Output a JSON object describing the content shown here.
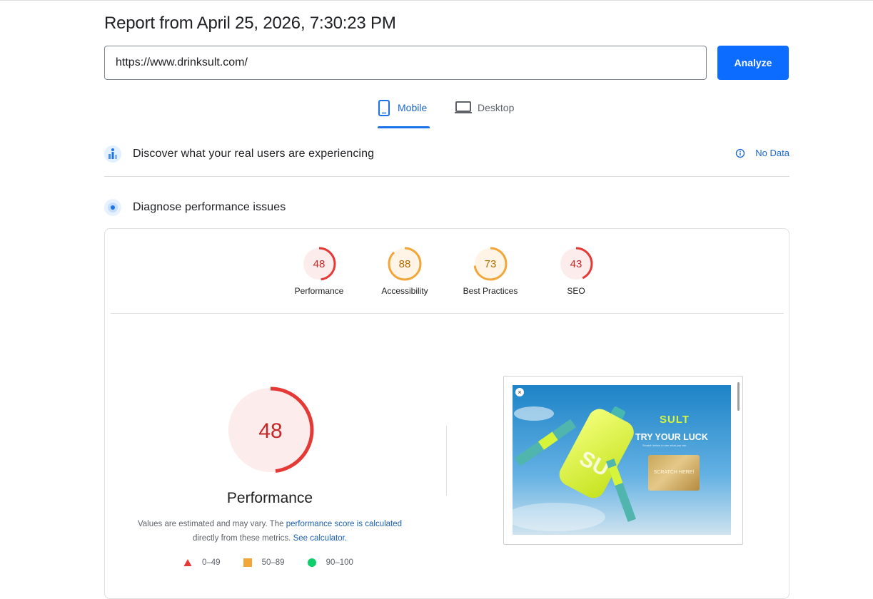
{
  "report": {
    "title": "Report from April 25, 2026, 7:30:23 PM"
  },
  "search": {
    "url": "https://www.drinksult.com/",
    "analyze_label": "Analyze"
  },
  "tabs": {
    "mobile": "Mobile",
    "desktop": "Desktop",
    "active": "Mobile"
  },
  "crux": {
    "title": "Discover what your real users are experiencing",
    "status": "No Data"
  },
  "diagnose": {
    "title": "Diagnose performance issues"
  },
  "categories": [
    {
      "label": "Performance",
      "score": "48",
      "level": "fail"
    },
    {
      "label": "Accessibility",
      "score": "88",
      "level": "average"
    },
    {
      "label": "Best Practices",
      "score": "73",
      "level": "average"
    },
    {
      "label": "SEO",
      "score": "43",
      "level": "fail"
    }
  ],
  "performance": {
    "score": "48",
    "title": "Performance",
    "note_prefix": "Values are estimated and may vary. The ",
    "note_link": "performance score is calculated",
    "note_mid": "directly from these metrics.",
    "note_link2": "See calculator.",
    "legend": [
      {
        "range": "0–49",
        "shape": "triangle"
      },
      {
        "range": "50–89",
        "shape": "square"
      },
      {
        "range": "90–100",
        "shape": "circle"
      }
    ]
  },
  "screenshot": {
    "brand": "SULT",
    "headline": "TRY YOUR LUCK",
    "subline": "Scratch below to see what you win",
    "scratch_label": "SCRATCH HERE!",
    "close": "×"
  },
  "colors": {
    "fail": "#e53935",
    "fail_bg": "#fdecec",
    "average": "#f2a63a",
    "average_bg": "#fff4e6",
    "pass": "#0cce6b",
    "accent": "#0b6cff"
  }
}
